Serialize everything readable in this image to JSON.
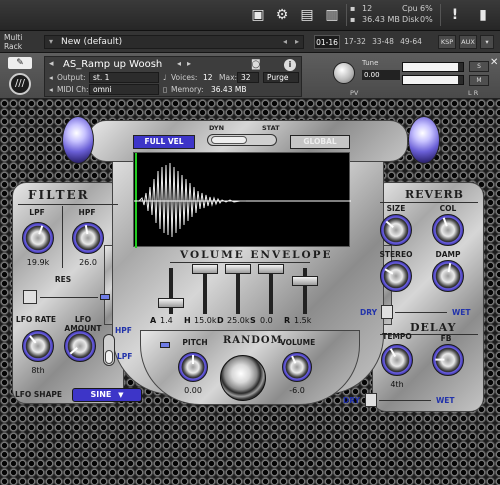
{
  "host": {
    "midi_count": "12",
    "memory": "36.43 MB",
    "cpu_label": "Cpu",
    "cpu_value": "6%",
    "disk_label": "Disk",
    "disk_value": "0%"
  },
  "rack": {
    "label_line1": "Multi",
    "label_line2": "Rack",
    "preset_name": "New (default)",
    "ranges": [
      "01-16",
      "17-32",
      "33-48",
      "49-64"
    ],
    "selected_range": "01-16",
    "buttons": [
      "KSP",
      "AUX"
    ]
  },
  "instrument": {
    "name": "AS_Ramp up Woosh",
    "output_label": "Output:",
    "output_value": "st. 1",
    "midi_label": "MIDI Ch:",
    "midi_value": "omni",
    "voices_label": "Voices:",
    "voices_value": "12",
    "max_label": "Max:",
    "max_value": "32",
    "purge_label": "Purge",
    "memory_label": "Memory:",
    "memory_value": "36.43 MB",
    "tune_label": "Tune",
    "tune_value": "0.00",
    "side_buttons": [
      "S",
      "M"
    ],
    "pv_label": "PV",
    "lr_label": "L  R",
    "meter_levels": [
      0.92,
      0.92
    ]
  },
  "tabs": {
    "full_vel": "FULL VEL",
    "global": "GLOBAL",
    "dyn": "DYN",
    "stat": "STAT"
  },
  "filter": {
    "title": "FILTER",
    "lpf_label": "LPF",
    "lpf_value": "19.9k",
    "hpf_label": "HPF",
    "hpf_value": "26.0",
    "res_label": "RES",
    "lfo_rate_label": "LFO RATE",
    "lfo_rate_value": "8th",
    "lfo_amount_label": "LFO AMOUNT",
    "hpf_switch_label": "HPF",
    "lpf_switch_label": "LPF",
    "lfo_shape_label": "LFO SHAPE",
    "lfo_shape_value": "SINE"
  },
  "envelope": {
    "title": "VOLUME ENVELOPE",
    "stages": [
      {
        "letter": "A",
        "value": "1.4"
      },
      {
        "letter": "H",
        "value": "15.0k"
      },
      {
        "letter": "D",
        "value": "25.0k"
      },
      {
        "letter": "S",
        "value": "0.0"
      },
      {
        "letter": "R",
        "value": "1.5k"
      }
    ]
  },
  "center": {
    "pitch_label": "PITCH",
    "pitch_value": "0.00",
    "random_label": "RANDOM",
    "volume_label": "VOLUME",
    "volume_value": "-6.0"
  },
  "reverb": {
    "title": "REVERB",
    "size_label": "SIZE",
    "col_label": "COL",
    "stereo_label": "STEREO",
    "damp_label": "DAMP",
    "dry_label": "DRY",
    "wet_label": "WET"
  },
  "delay": {
    "title": "DELAY",
    "tempo_label": "TEMPO",
    "tempo_value": "4th",
    "fb_label": "FB",
    "dry_label": "DRY",
    "wet_label": "WET"
  },
  "colors": {
    "accent_blue": "#3d35c8",
    "knob_ring": "#6e63e6",
    "waveform_marker": "#22cc22"
  }
}
